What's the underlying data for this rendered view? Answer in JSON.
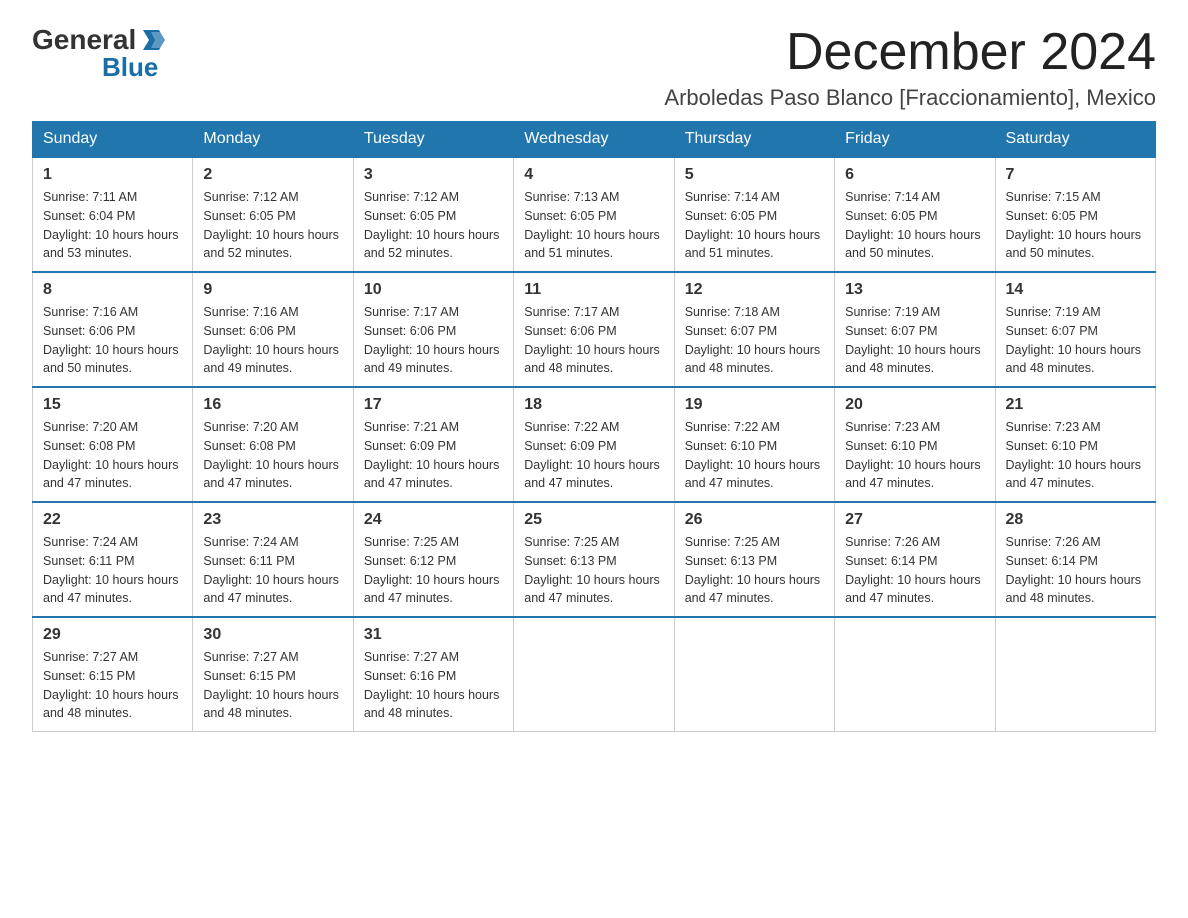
{
  "logo": {
    "general": "General",
    "blue": "Blue"
  },
  "title": {
    "month": "December 2024",
    "location": "Arboledas Paso Blanco [Fraccionamiento], Mexico"
  },
  "weekdays": [
    "Sunday",
    "Monday",
    "Tuesday",
    "Wednesday",
    "Thursday",
    "Friday",
    "Saturday"
  ],
  "weeks": [
    [
      {
        "day": "1",
        "sunrise": "7:11 AM",
        "sunset": "6:04 PM",
        "daylight": "10 hours and 53 minutes."
      },
      {
        "day": "2",
        "sunrise": "7:12 AM",
        "sunset": "6:05 PM",
        "daylight": "10 hours and 52 minutes."
      },
      {
        "day": "3",
        "sunrise": "7:12 AM",
        "sunset": "6:05 PM",
        "daylight": "10 hours and 52 minutes."
      },
      {
        "day": "4",
        "sunrise": "7:13 AM",
        "sunset": "6:05 PM",
        "daylight": "10 hours and 51 minutes."
      },
      {
        "day": "5",
        "sunrise": "7:14 AM",
        "sunset": "6:05 PM",
        "daylight": "10 hours and 51 minutes."
      },
      {
        "day": "6",
        "sunrise": "7:14 AM",
        "sunset": "6:05 PM",
        "daylight": "10 hours and 50 minutes."
      },
      {
        "day": "7",
        "sunrise": "7:15 AM",
        "sunset": "6:05 PM",
        "daylight": "10 hours and 50 minutes."
      }
    ],
    [
      {
        "day": "8",
        "sunrise": "7:16 AM",
        "sunset": "6:06 PM",
        "daylight": "10 hours and 50 minutes."
      },
      {
        "day": "9",
        "sunrise": "7:16 AM",
        "sunset": "6:06 PM",
        "daylight": "10 hours and 49 minutes."
      },
      {
        "day": "10",
        "sunrise": "7:17 AM",
        "sunset": "6:06 PM",
        "daylight": "10 hours and 49 minutes."
      },
      {
        "day": "11",
        "sunrise": "7:17 AM",
        "sunset": "6:06 PM",
        "daylight": "10 hours and 48 minutes."
      },
      {
        "day": "12",
        "sunrise": "7:18 AM",
        "sunset": "6:07 PM",
        "daylight": "10 hours and 48 minutes."
      },
      {
        "day": "13",
        "sunrise": "7:19 AM",
        "sunset": "6:07 PM",
        "daylight": "10 hours and 48 minutes."
      },
      {
        "day": "14",
        "sunrise": "7:19 AM",
        "sunset": "6:07 PM",
        "daylight": "10 hours and 48 minutes."
      }
    ],
    [
      {
        "day": "15",
        "sunrise": "7:20 AM",
        "sunset": "6:08 PM",
        "daylight": "10 hours and 47 minutes."
      },
      {
        "day": "16",
        "sunrise": "7:20 AM",
        "sunset": "6:08 PM",
        "daylight": "10 hours and 47 minutes."
      },
      {
        "day": "17",
        "sunrise": "7:21 AM",
        "sunset": "6:09 PM",
        "daylight": "10 hours and 47 minutes."
      },
      {
        "day": "18",
        "sunrise": "7:22 AM",
        "sunset": "6:09 PM",
        "daylight": "10 hours and 47 minutes."
      },
      {
        "day": "19",
        "sunrise": "7:22 AM",
        "sunset": "6:10 PM",
        "daylight": "10 hours and 47 minutes."
      },
      {
        "day": "20",
        "sunrise": "7:23 AM",
        "sunset": "6:10 PM",
        "daylight": "10 hours and 47 minutes."
      },
      {
        "day": "21",
        "sunrise": "7:23 AM",
        "sunset": "6:10 PM",
        "daylight": "10 hours and 47 minutes."
      }
    ],
    [
      {
        "day": "22",
        "sunrise": "7:24 AM",
        "sunset": "6:11 PM",
        "daylight": "10 hours and 47 minutes."
      },
      {
        "day": "23",
        "sunrise": "7:24 AM",
        "sunset": "6:11 PM",
        "daylight": "10 hours and 47 minutes."
      },
      {
        "day": "24",
        "sunrise": "7:25 AM",
        "sunset": "6:12 PM",
        "daylight": "10 hours and 47 minutes."
      },
      {
        "day": "25",
        "sunrise": "7:25 AM",
        "sunset": "6:13 PM",
        "daylight": "10 hours and 47 minutes."
      },
      {
        "day": "26",
        "sunrise": "7:25 AM",
        "sunset": "6:13 PM",
        "daylight": "10 hours and 47 minutes."
      },
      {
        "day": "27",
        "sunrise": "7:26 AM",
        "sunset": "6:14 PM",
        "daylight": "10 hours and 47 minutes."
      },
      {
        "day": "28",
        "sunrise": "7:26 AM",
        "sunset": "6:14 PM",
        "daylight": "10 hours and 48 minutes."
      }
    ],
    [
      {
        "day": "29",
        "sunrise": "7:27 AM",
        "sunset": "6:15 PM",
        "daylight": "10 hours and 48 minutes."
      },
      {
        "day": "30",
        "sunrise": "7:27 AM",
        "sunset": "6:15 PM",
        "daylight": "10 hours and 48 minutes."
      },
      {
        "day": "31",
        "sunrise": "7:27 AM",
        "sunset": "6:16 PM",
        "daylight": "10 hours and 48 minutes."
      },
      null,
      null,
      null,
      null
    ]
  ],
  "labels": {
    "sunrise": "Sunrise:",
    "sunset": "Sunset:",
    "daylight": "Daylight:"
  }
}
